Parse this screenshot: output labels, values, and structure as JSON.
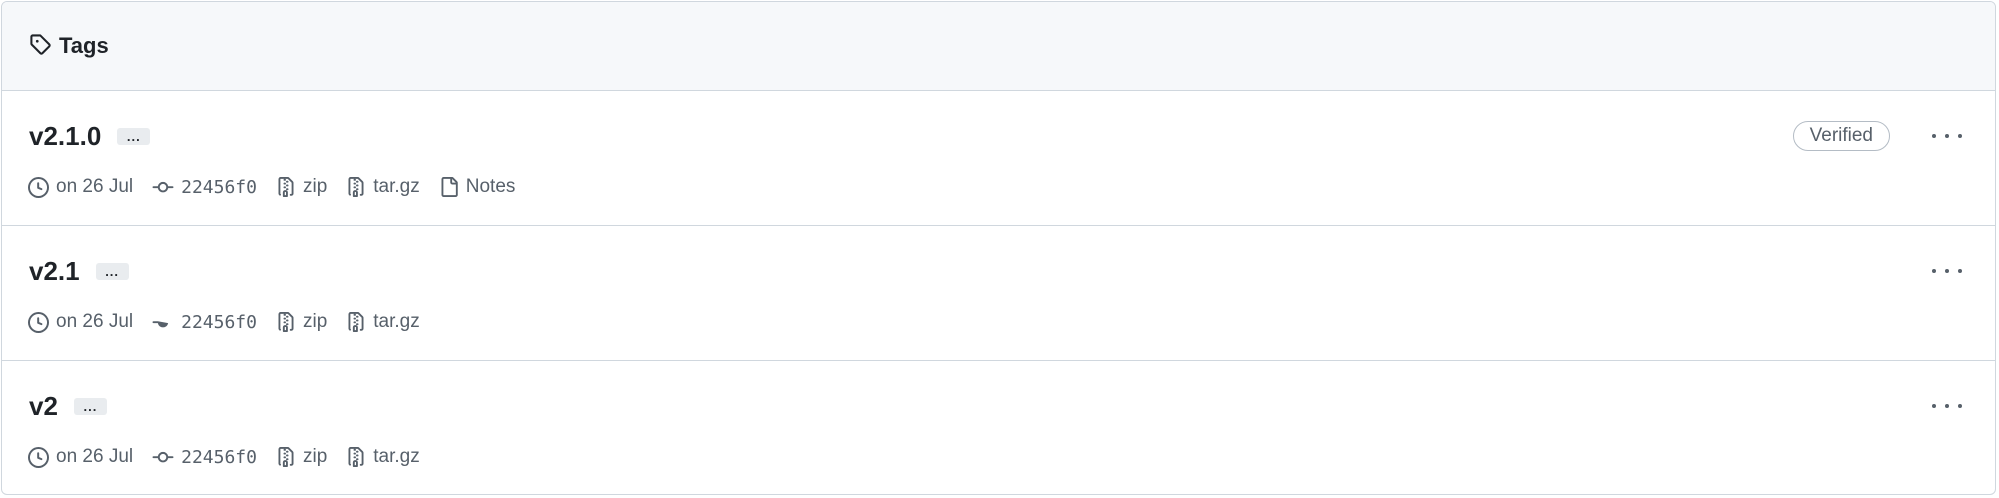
{
  "header": {
    "title": "Tags",
    "icon": "tag-icon"
  },
  "tags": [
    {
      "name": "v2.1.0",
      "ellipsis": "...",
      "date": "on 26 Jul",
      "commit": "22456f0",
      "zip": "zip",
      "targz": "tar.gz",
      "notes": "Notes",
      "verified": "Verified"
    },
    {
      "name": "v2.1",
      "ellipsis": "...",
      "date": "on 26 Jul",
      "commit": "22456f0",
      "zip": "zip",
      "targz": "tar.gz"
    },
    {
      "name": "v2",
      "ellipsis": "...",
      "date": "on 26 Jul",
      "commit": "22456f0",
      "zip": "zip",
      "targz": "tar.gz"
    }
  ],
  "colors": {
    "text": "#1f2328",
    "muted": "#57606a",
    "border": "#d0d7de",
    "header_bg": "#f6f8fa"
  }
}
